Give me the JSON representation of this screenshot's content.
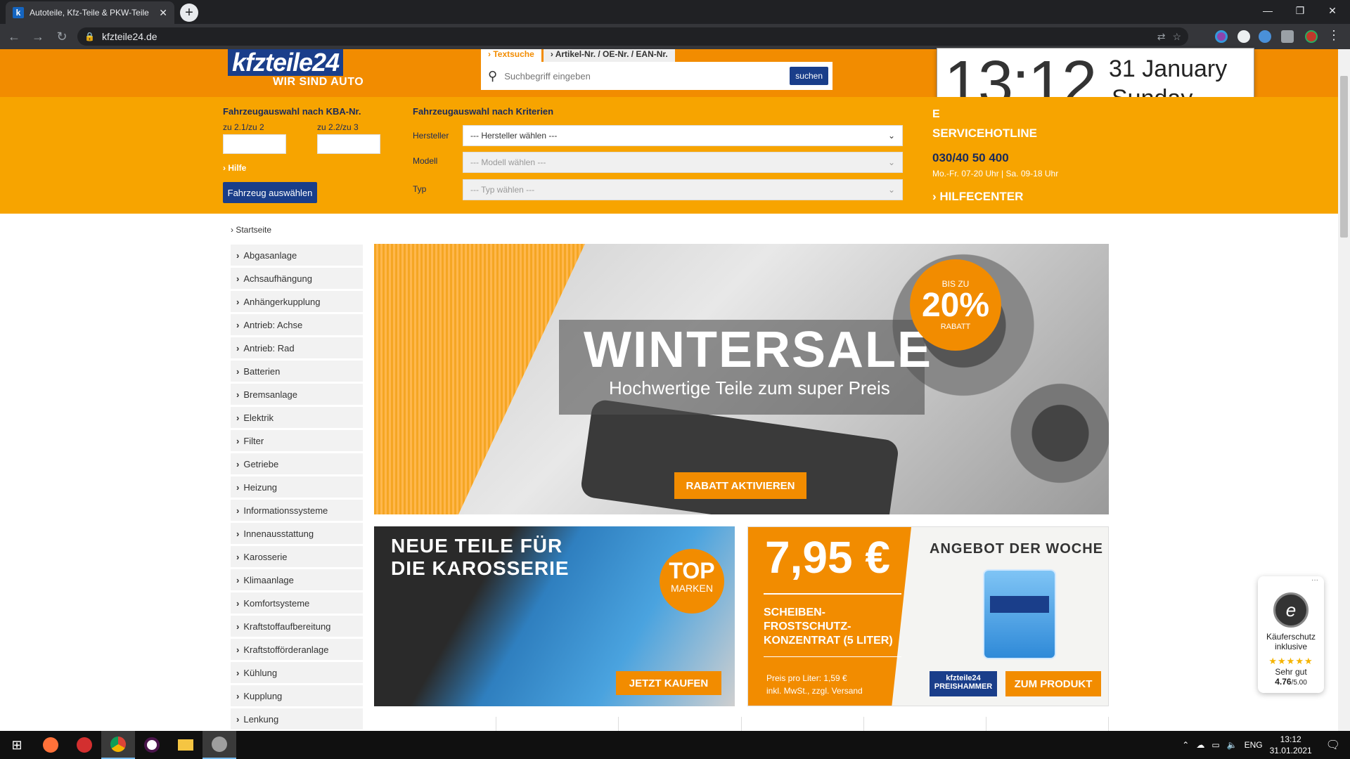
{
  "browser": {
    "tab_title": "Autoteile, Kfz-Teile & PKW-Teile",
    "tab_close": "✕",
    "new_tab": "+",
    "url": "kfzteile24.de",
    "window_controls": [
      "—",
      "❐",
      "✕"
    ]
  },
  "header": {
    "logo_main": "kfzteile24",
    "logo_tagline": "WIR SIND AUTO",
    "search_tabs": [
      "Textsuche",
      "Artikel-Nr. / OE-Nr. / EAN-Nr."
    ],
    "search_placeholder": "Suchbegriff eingeben",
    "search_button": "suchen"
  },
  "vehicle": {
    "kba_title": "Fahrzeugauswahl nach KBA-Nr.",
    "kba_field1_label": "zu 2.1/zu 2",
    "kba_field2_label": "zu 2.2/zu 3",
    "help_link": "Hilfe",
    "select_button": "Fahrzeug auswählen",
    "criteria_title": "Fahrzeugauswahl nach Kriterien",
    "rows": [
      {
        "label": "Hersteller",
        "value": "--- Hersteller wählen ---"
      },
      {
        "label": "Modell",
        "value": "--- Modell wählen ---"
      },
      {
        "label": "Typ",
        "value": "--- Typ wählen ---"
      }
    ]
  },
  "hotline": {
    "initial": "E",
    "title": "SERVICEHOTLINE",
    "phone": "030/40 50 400",
    "hours": "Mo.-Fr. 07-20 Uhr | Sa. 09-18 Uhr",
    "helpcenter": "HILFECENTER"
  },
  "clock": {
    "hours": "13",
    "minutes": "12",
    "day": "31",
    "month": "January",
    "weekday": "Sunday"
  },
  "breadcrumb": "Startseite",
  "categories": [
    "Abgasanlage",
    "Achsaufhängung",
    "Anhängerkupplung",
    "Antrieb: Achse",
    "Antrieb: Rad",
    "Batterien",
    "Bremsanlage",
    "Elektrik",
    "Filter",
    "Getriebe",
    "Heizung",
    "Informationssysteme",
    "Innenausstattung",
    "Karosserie",
    "Klimaanlage",
    "Komfortsysteme",
    "Kraftstoffaufbereitung",
    "Kraftstofförderanlage",
    "Kühlung",
    "Kupplung",
    "Lenkung"
  ],
  "hero": {
    "title": "WINTERSALE",
    "subtitle": "Hochwertige Teile zum super Preis",
    "badge_top": "BIS ZU",
    "badge_value": "20%",
    "badge_bottom": "RABATT",
    "cta": "RABATT AKTIVIEREN"
  },
  "banner_karosserie": {
    "title_line1": "NEUE TEILE FÜR",
    "title_line2": "DIE KAROSSERIE",
    "badge_top": "TOP",
    "badge_bottom": "MARKEN",
    "cta": "JETZT KAUFEN"
  },
  "banner_offer": {
    "price": "7,95 €",
    "product_line1": "SCHEIBEN-",
    "product_line2": "FROSTSCHUTZ-",
    "product_line3": "KONZENTRAT (5 LITER)",
    "price_per_liter": "Preis pro Liter: 1,59 €",
    "tax_note": "inkl. MwSt., zzgl. Versand",
    "headline": "ANGEBOT DER WOCHE",
    "mini_logo_top": "kfzteile24",
    "mini_logo_bottom": "PREISHAMMER",
    "cta": "ZUM PRODUKT"
  },
  "trust_badge": {
    "more": "···",
    "seal_letter": "e",
    "line1": "Käuferschutz",
    "line2": "inklusive",
    "stars": "★★★★★",
    "rating_text": "Sehr gut",
    "score": "4.76",
    "max": "/5.00"
  },
  "taskbar": {
    "lang": "ENG",
    "time": "13:12",
    "date": "31.01.2021"
  }
}
